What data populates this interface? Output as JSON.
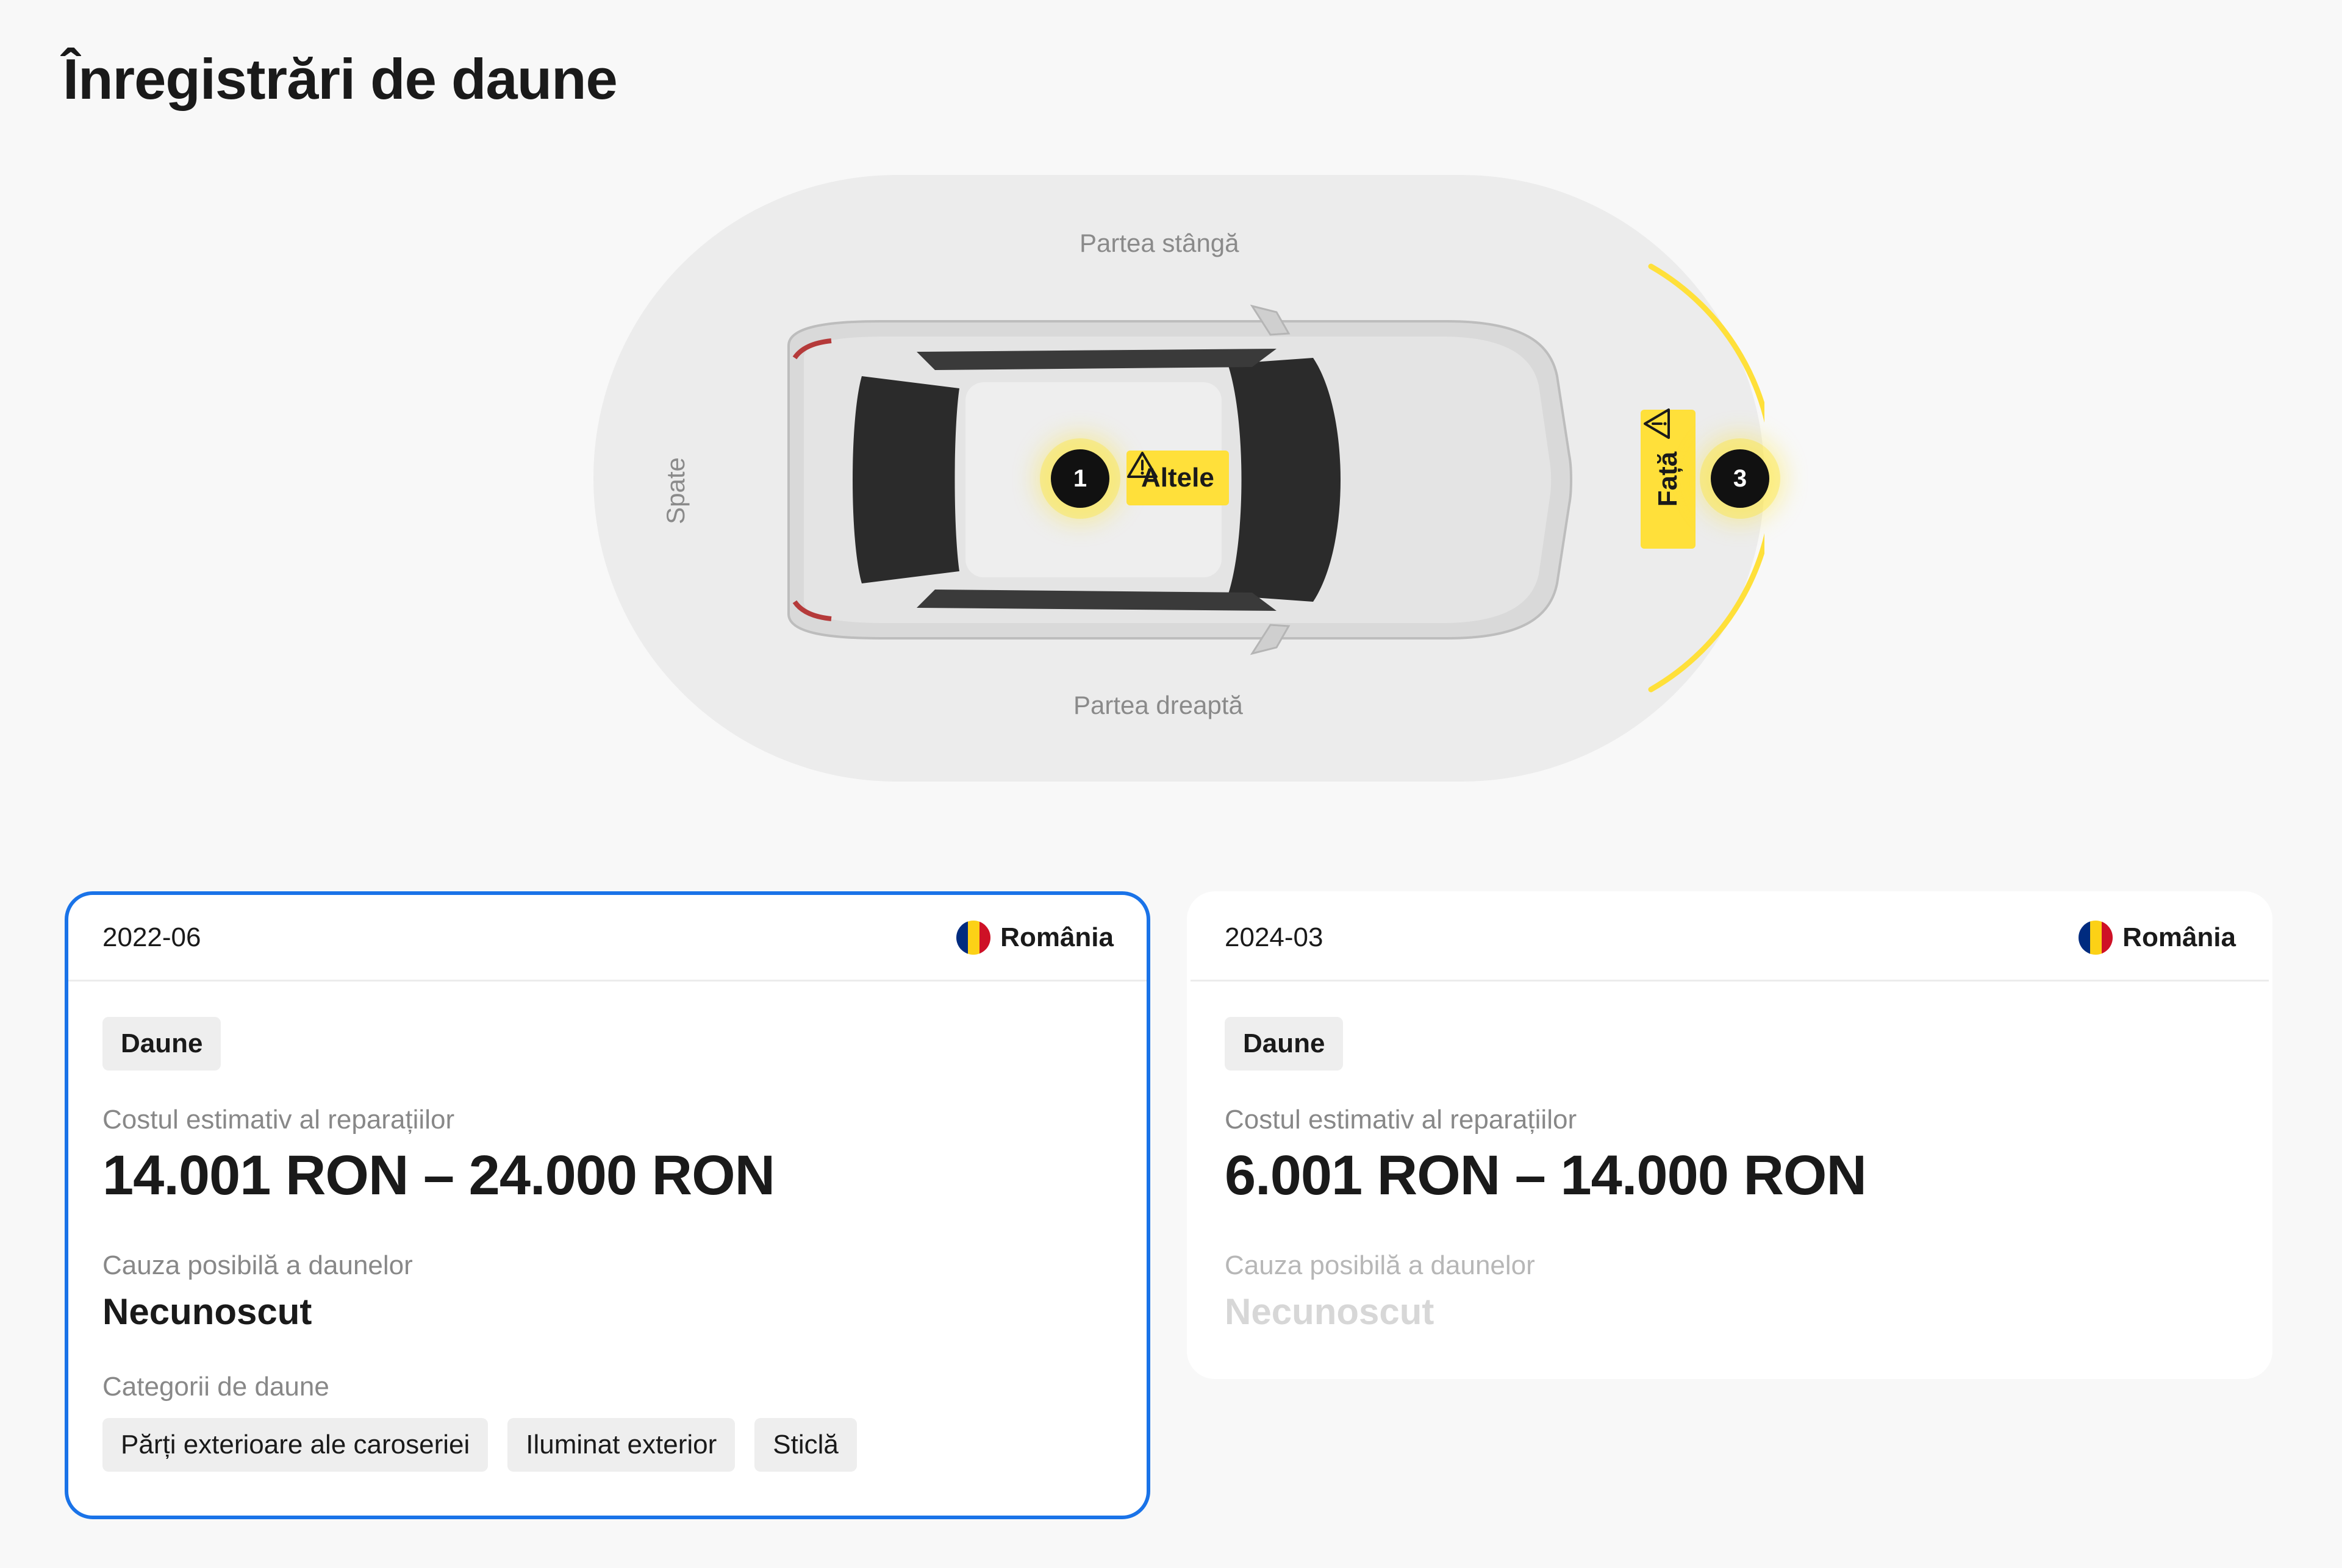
{
  "page": {
    "title": "Înregistrări de daune"
  },
  "diagram": {
    "labels": {
      "left_side": "Partea stângă",
      "right_side": "Partea dreaptă",
      "rear": "Spate"
    },
    "markers": [
      {
        "number": "1",
        "tag": "Altele",
        "icon": "warning-icon"
      },
      {
        "number": "3",
        "tag": "Față",
        "icon": "warning-icon"
      }
    ],
    "colors": {
      "highlight": "#ffe03a",
      "arc": "#ffe03a",
      "background": "#ececec"
    }
  },
  "records": [
    {
      "date": "2022-06",
      "country": "România",
      "flag_colors": [
        "#002b7f",
        "#fcd116",
        "#ce1126"
      ],
      "type": "Daune",
      "cost_label": "Costul estimativ al reparațiilor",
      "cost_value": "14.001 RON – 24.000 RON",
      "cause_label": "Cauza posibilă a daunelor",
      "cause_value": "Necunoscut",
      "categories_label": "Categorii de daune",
      "categories": [
        "Părți exterioare ale caroseriei",
        "Iluminat exterior",
        "Sticlă"
      ],
      "selected": true
    },
    {
      "date": "2024-03",
      "country": "România",
      "flag_colors": [
        "#002b7f",
        "#fcd116",
        "#ce1126"
      ],
      "type": "Daune",
      "cost_label": "Costul estimativ al reparațiilor",
      "cost_value": "6.001 RON – 14.000 RON",
      "cause_label": "Cauza posibilă a daunelor",
      "cause_value": "Necunoscut",
      "selected": false
    }
  ],
  "colors": {
    "selected_border": "#1a73e8",
    "page_background": "#f8f8f8"
  }
}
